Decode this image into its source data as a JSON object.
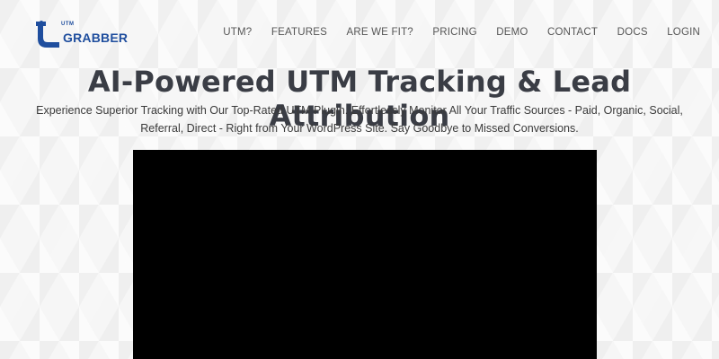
{
  "logo": {
    "small_text": "UTM",
    "word": "GRABBER",
    "icon": "magnet-hook-icon",
    "brand_color": "#1f4e9e"
  },
  "nav": {
    "items": [
      {
        "label": "UTM?"
      },
      {
        "label": "FEATURES"
      },
      {
        "label": "ARE WE FIT?"
      },
      {
        "label": "PRICING"
      },
      {
        "label": "DEMO"
      },
      {
        "label": "CONTACT"
      },
      {
        "label": "DOCS"
      },
      {
        "label": "LOGIN"
      }
    ]
  },
  "hero": {
    "title": "AI-Powered UTM Tracking & Lead Attribution",
    "subtitle": "Experience Superior Tracking with Our Top-Rated UTM Plugin. Effortlessly Monitor All Your Traffic Sources - Paid, Organic, Social, Referral, Direct - Right from Your WordPress Site. Say Goodbye to Missed Conversions."
  },
  "video": {
    "background": "#000000"
  }
}
